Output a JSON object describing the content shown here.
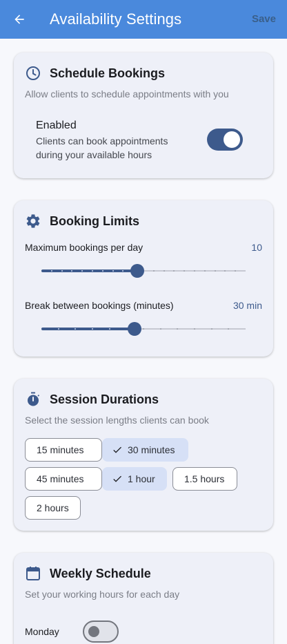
{
  "appbar": {
    "title": "Availability Settings",
    "save_label": "Save",
    "back_icon": "arrow-left-icon"
  },
  "schedule_bookings": {
    "title": "Schedule Bookings",
    "icon": "clock-icon",
    "subtitle": "Allow clients to schedule appointments with you",
    "toggle_label": "Enabled",
    "toggle_desc": "Clients can book appointments during your available hours",
    "enabled": true
  },
  "booking_limits": {
    "title": "Booking Limits",
    "icon": "gear-icon",
    "max_per_day": {
      "label": "Maximum bookings per day",
      "value_text": "10",
      "level": 0.47
    },
    "break_between": {
      "label": "Break between bookings (minutes)",
      "value_text": "30 min",
      "level": 0.455
    }
  },
  "session_durations": {
    "title": "Session Durations",
    "icon": "stopwatch-icon",
    "subtitle": "Select the session lengths clients can book",
    "options": [
      {
        "label": "15 minutes",
        "selected": false
      },
      {
        "label": "30 minutes",
        "selected": true
      },
      {
        "label": "45 minutes",
        "selected": false
      },
      {
        "label": "1 hour",
        "selected": true
      },
      {
        "label": "1.5 hours",
        "selected": false
      },
      {
        "label": "2 hours",
        "selected": false
      }
    ]
  },
  "weekly_schedule": {
    "title": "Weekly Schedule",
    "icon": "calendar-icon",
    "subtitle": "Set your working hours for each day",
    "days": [
      {
        "label": "Monday",
        "enabled": false
      }
    ]
  },
  "colors": {
    "appbar": "#4a89dc",
    "accent": "#3d5a8c",
    "card": "#eef0f8",
    "chip_selected": "#d6e0f6"
  }
}
